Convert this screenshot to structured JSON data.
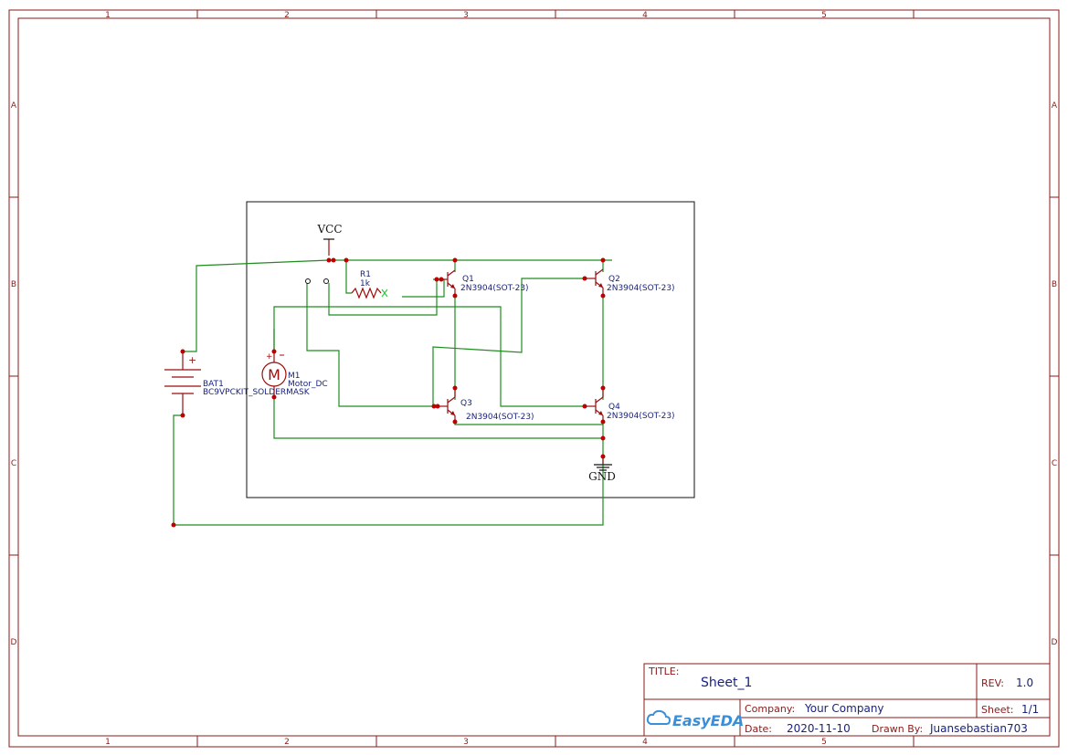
{
  "sheet": {
    "zone_columns": [
      "1",
      "2",
      "3",
      "4",
      "5"
    ],
    "zone_rows": [
      "A",
      "B",
      "C",
      "D"
    ],
    "colors": {
      "frame": "#8b1a1a",
      "wire": "#1e8c1e",
      "component": "#9b0d0d",
      "junction": "#c00000",
      "text": "#1a237e"
    }
  },
  "schematic": {
    "nets": {
      "vcc": "VCC",
      "gnd": "GND"
    },
    "components": {
      "r1": {
        "ref": "R1",
        "value": "1k"
      },
      "bat1": {
        "ref": "BAT1",
        "value": "BC9VPCKIT_SOLDERMASK",
        "polarity": "+"
      },
      "m1": {
        "ref": "M1",
        "value": "Motor_DC",
        "symbol": "M",
        "polarity": "+"
      },
      "q1": {
        "ref": "Q1",
        "value": "2N3904(SOT-23)"
      },
      "q2": {
        "ref": "Q2",
        "value": "2N3904(SOT-23)"
      },
      "q3": {
        "ref": "Q3",
        "value": "2N3904(SOT-23)"
      },
      "q4": {
        "ref": "Q4",
        "value": "2N3904(SOT-23)"
      }
    }
  },
  "title_block": {
    "title_label": "TITLE:",
    "title": "Sheet_1",
    "rev_label": "REV:",
    "rev": "1.0",
    "company_label": "Company:",
    "company": "Your Company",
    "sheet_label": "Sheet:",
    "sheet": "1/1",
    "date_label": "Date:",
    "date": "2020-11-10",
    "drawn_by_label": "Drawn By:",
    "drawn_by": "Juansebastian703",
    "logo_text": "EasyEDA"
  }
}
